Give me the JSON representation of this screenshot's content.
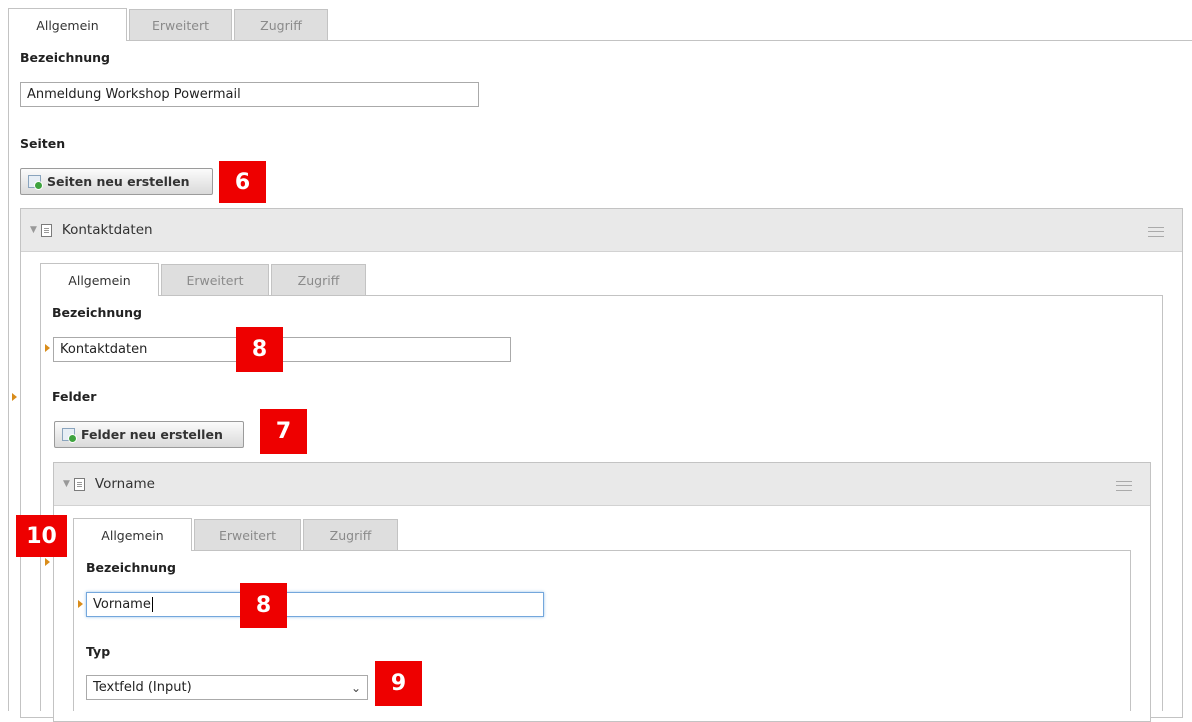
{
  "tabs": [
    "Allgemein",
    "Erweitert",
    "Zugriff"
  ],
  "form": {
    "bezeichnung_label": "Bezeichnung",
    "bezeichnung_value": "Anmeldung Workshop Powermail",
    "seiten_label": "Seiten",
    "seiten_button": "Seiten neu erstellen"
  },
  "page_record": {
    "title": "Kontaktdaten",
    "tabs": [
      "Allgemein",
      "Erweitert",
      "Zugriff"
    ],
    "bezeichnung_label": "Bezeichnung",
    "bezeichnung_value": "Kontaktdaten",
    "felder_label": "Felder",
    "felder_button": "Felder neu erstellen"
  },
  "field_record": {
    "title": "Vorname",
    "tabs": [
      "Allgemein",
      "Erweitert",
      "Zugriff"
    ],
    "bezeichnung_label": "Bezeichnung",
    "bezeichnung_value": "Vorname",
    "typ_label": "Typ",
    "typ_value": "Textfeld (Input)"
  },
  "callouts": [
    "6",
    "8",
    "7",
    "10",
    "8",
    "9"
  ],
  "colors": {
    "callout": "#ee0000",
    "marker": "#d98c1a",
    "focus_border": "#74a7dc"
  },
  "icons": [
    "new-record-icon",
    "page-record-icon",
    "collapse-arrow-icon",
    "drag-handle-icon",
    "chevron-down-icon"
  ]
}
